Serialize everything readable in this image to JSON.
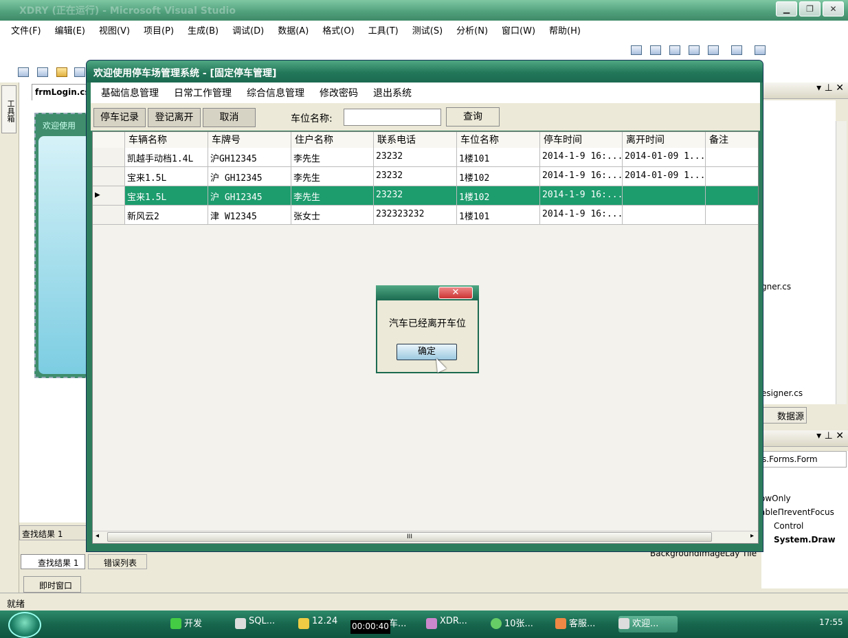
{
  "vs": {
    "title": "XDRY (正在运行) - Microsoft Visual Studio",
    "menu": [
      "文件(F)",
      "编辑(E)",
      "视图(V)",
      "项目(P)",
      "生成(B)",
      "调试(D)",
      "数据(A)",
      "格式(O)",
      "工具(T)",
      "测试(S)",
      "分析(N)",
      "窗口(W)",
      "帮助(H)"
    ],
    "toolbox_tab": "工具箱",
    "doc_tab": "frmLogin.cs",
    "designer_caption": "欢迎使用",
    "find_results_header": "查找结果 1",
    "find_results_tab": "查找结果 1",
    "error_list_tab": "错误列表",
    "immediate_tab": "即时窗口",
    "right_panel": {
      "file1": "gner.cs",
      "file2": "esigner.cs",
      "data_source_tab": "数据源",
      "props_combo": "s.Forms.Form",
      "prop_rows": [
        "owOnly",
        "ableПreventFocus",
        "Control",
        "System.Draw",
        "BackgroundImageLay  Tile"
      ]
    },
    "status": "就绪"
  },
  "app": {
    "title": "欢迎使用停车场管理系统 - [固定停车管理]",
    "menu": [
      "基础信息管理",
      "日常工作管理",
      "综合信息管理",
      "修改密码",
      "退出系统"
    ],
    "toolbar": {
      "btn_park": "停车记录",
      "btn_leave": "登记离开",
      "btn_cancel": "取消",
      "space_label": "车位名称:",
      "space_value": "",
      "btn_query": "查询"
    },
    "grid": {
      "columns": [
        "车辆名称",
        "车牌号",
        "住户名称",
        "联系电话",
        "车位名称",
        "停车时间",
        "离开时间",
        "备注"
      ],
      "rows": [
        [
          "凯越手动档1.4L",
          "沪GH12345",
          "李先生",
          "23232",
          "1楼101",
          "2014-1-9 16:...",
          "2014-01-09 1...",
          ""
        ],
        [
          "宝来1.5L",
          "沪 GH12345",
          "李先生",
          "23232",
          "1楼102",
          "2014-1-9 16:...",
          "2014-01-09 1...",
          ""
        ],
        [
          "宝来1.5L",
          "沪 GH12345",
          "李先生",
          "23232",
          "1楼102",
          "2014-1-9 16:...",
          "",
          ""
        ],
        [
          "新风云2",
          "津 W12345",
          "张女士",
          "232323232",
          "1楼101",
          "2014-1-9 16:...",
          "",
          ""
        ]
      ],
      "selected_row": 2,
      "row_pointer": "▶",
      "hscroll_grip": "III"
    }
  },
  "dialog": {
    "close": "✕",
    "message": "汽车已经离开车位",
    "ok": "确定"
  },
  "taskbar": {
    "items": [
      "开发",
      "SQL...",
      "12.24",
      "车...",
      "XDR...",
      "10张...",
      "客服...",
      "欢迎..."
    ],
    "timer": "00:00:40",
    "clock": "17:55"
  }
}
